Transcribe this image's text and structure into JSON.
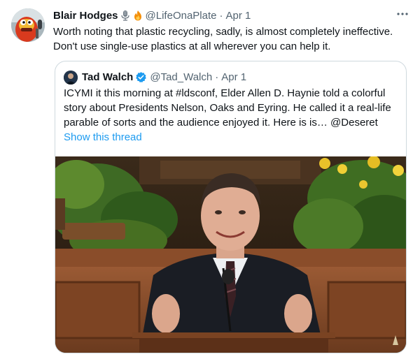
{
  "tweet": {
    "author_name": "Blair Hodges",
    "author_handle": "@LifeOnaPlate",
    "date": "Apr 1",
    "separator": "·",
    "more_icon": "more-horizontal-icon",
    "text": "Worth noting that plastic recycling, sadly, is almost completely ineffective. Don't use single-use plastics at all wherever you can help it."
  },
  "quoted": {
    "author_name": "Tad Walch",
    "author_handle": "@Tad_Walch",
    "date": "Apr 1",
    "separator": "·",
    "verified_icon": "verified-badge-icon",
    "text": "ICYMI it this morning at #ldsconf, Elder Allen D. Haynie told a colorful story about Presidents Nelson, Oaks and Eyring. He called it a real-life parable of sorts and the audience enjoyed it. Here is is… @Deseret",
    "show_thread": "Show this thread"
  },
  "colors": {
    "link": "#1d9bf0",
    "secondary_text": "#536471",
    "border": "#cfd9de"
  }
}
